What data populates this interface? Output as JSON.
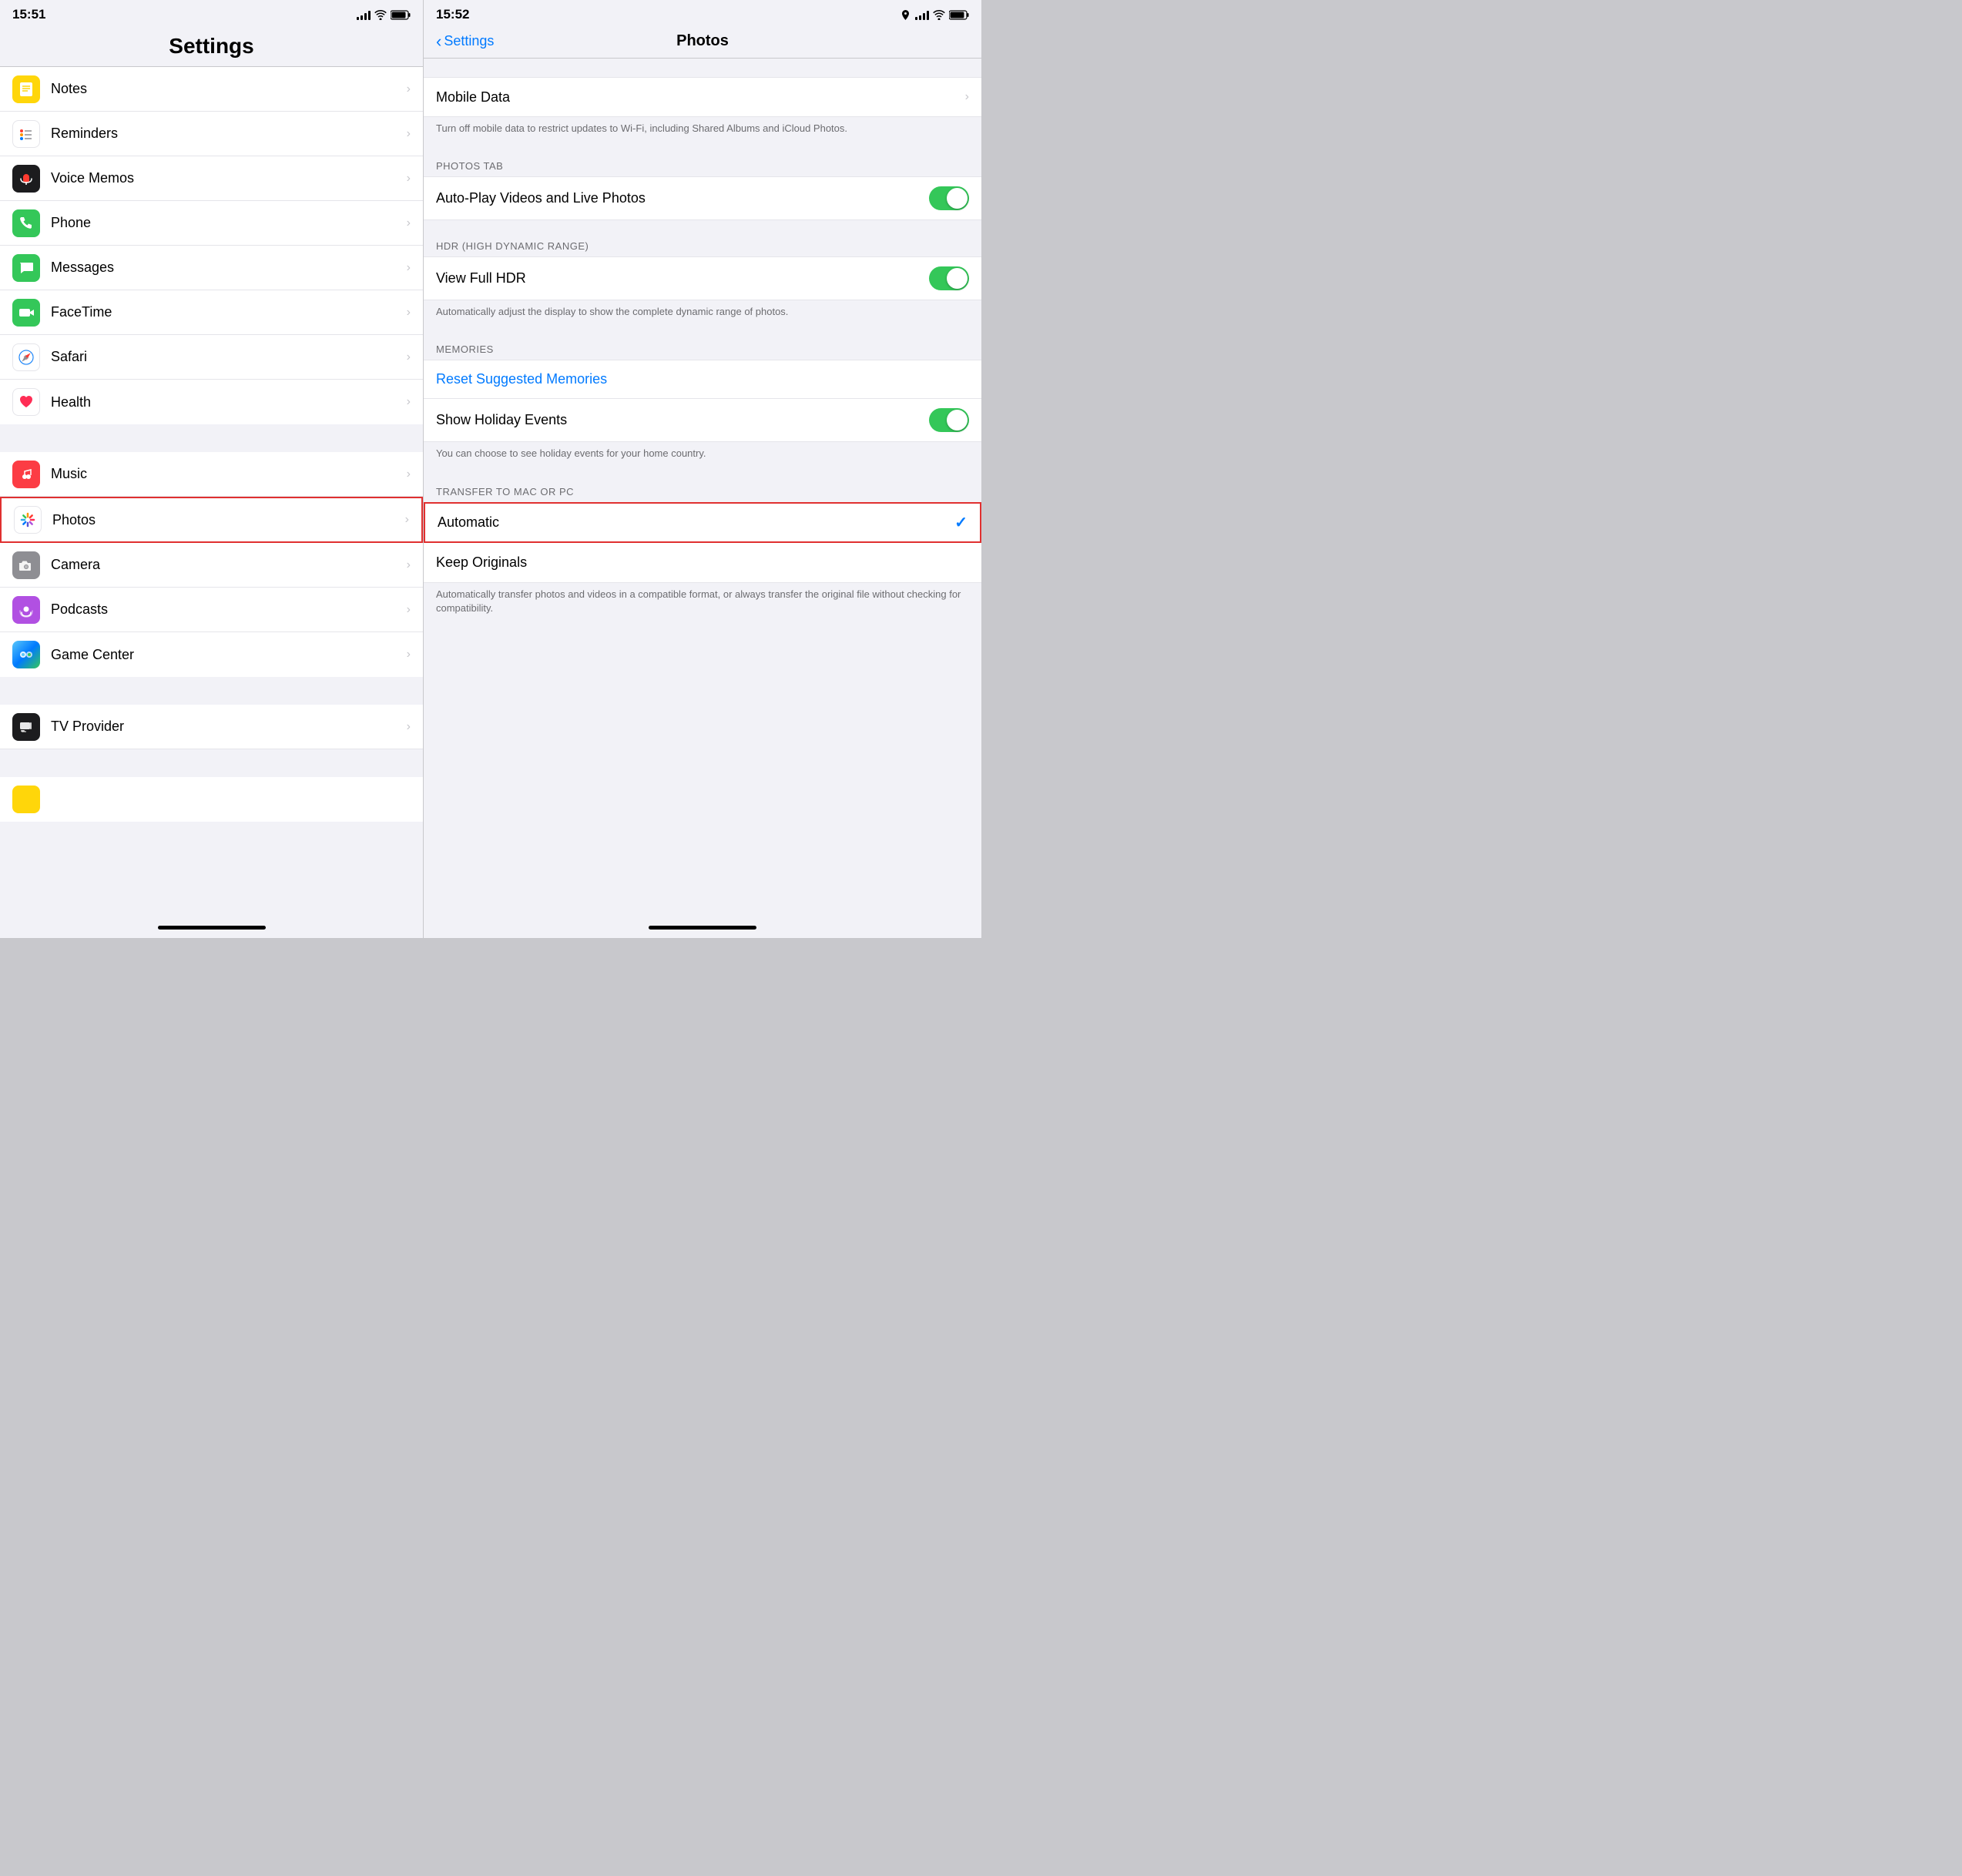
{
  "left": {
    "statusBar": {
      "time": "15:51",
      "locationIcon": "◀",
      "signalBars": [
        4,
        6,
        8,
        10,
        12
      ],
      "wifiIcon": "wifi",
      "batteryIcon": "battery"
    },
    "header": "Settings",
    "items": [
      {
        "id": "notes",
        "label": "Notes",
        "icon": "notes",
        "highlighted": false
      },
      {
        "id": "reminders",
        "label": "Reminders",
        "icon": "reminders",
        "highlighted": false
      },
      {
        "id": "voicememos",
        "label": "Voice Memos",
        "icon": "voicememos",
        "highlighted": false
      },
      {
        "id": "phone",
        "label": "Phone",
        "icon": "phone",
        "highlighted": false
      },
      {
        "id": "messages",
        "label": "Messages",
        "icon": "messages",
        "highlighted": false
      },
      {
        "id": "facetime",
        "label": "FaceTime",
        "icon": "facetime",
        "highlighted": false
      },
      {
        "id": "safari",
        "label": "Safari",
        "icon": "safari",
        "highlighted": false
      },
      {
        "id": "health",
        "label": "Health",
        "icon": "health",
        "highlighted": false
      },
      {
        "id": "music",
        "label": "Music",
        "icon": "music",
        "highlighted": false
      },
      {
        "id": "photos",
        "label": "Photos",
        "icon": "photos",
        "highlighted": true
      },
      {
        "id": "camera",
        "label": "Camera",
        "icon": "camera",
        "highlighted": false
      },
      {
        "id": "podcasts",
        "label": "Podcasts",
        "icon": "podcasts",
        "highlighted": false
      },
      {
        "id": "gamecenter",
        "label": "Game Center",
        "icon": "gamecenter",
        "highlighted": false
      },
      {
        "id": "tvprovider",
        "label": "TV Provider",
        "icon": "tvprovider",
        "highlighted": false
      }
    ],
    "separators": [
      8,
      12
    ]
  },
  "right": {
    "statusBar": {
      "time": "15:52"
    },
    "navBack": "Settings",
    "navTitle": "Photos",
    "sections": [
      {
        "id": "mobiledata",
        "header": null,
        "cells": [
          {
            "id": "mobiledata",
            "label": "Mobile Data",
            "type": "chevron",
            "highlighted": false
          }
        ],
        "footer": "Turn off mobile data to restrict updates to Wi-Fi, including Shared Albums and iCloud Photos."
      },
      {
        "id": "photostab",
        "header": "PHOTOS TAB",
        "cells": [
          {
            "id": "autoplay",
            "label": "Auto-Play Videos and Live Photos",
            "type": "toggle",
            "toggleOn": true,
            "highlighted": false
          }
        ],
        "footer": null
      },
      {
        "id": "hdr",
        "header": "HDR (HIGH DYNAMIC RANGE)",
        "cells": [
          {
            "id": "viewfullhdr",
            "label": "View Full HDR",
            "type": "toggle",
            "toggleOn": true,
            "highlighted": false
          }
        ],
        "footer": "Automatically adjust the display to show the complete dynamic range of photos."
      },
      {
        "id": "memories",
        "header": "MEMORIES",
        "cells": [
          {
            "id": "resetmemories",
            "label": "Reset Suggested Memories",
            "type": "link",
            "highlighted": false
          },
          {
            "id": "showhol",
            "label": "Show Holiday Events",
            "type": "toggle",
            "toggleOn": true,
            "highlighted": false
          }
        ],
        "footer": "You can choose to see holiday events for your home country."
      },
      {
        "id": "transfer",
        "header": "TRANSFER TO MAC OR PC",
        "cells": [
          {
            "id": "automatic",
            "label": "Automatic",
            "type": "checkmark",
            "checked": true,
            "highlighted": true
          },
          {
            "id": "keeporiginals",
            "label": "Keep Originals",
            "type": "none",
            "highlighted": false
          }
        ],
        "footer": "Automatically transfer photos and videos in a compatible format, or always transfer the original file without checking for compatibility."
      }
    ]
  }
}
